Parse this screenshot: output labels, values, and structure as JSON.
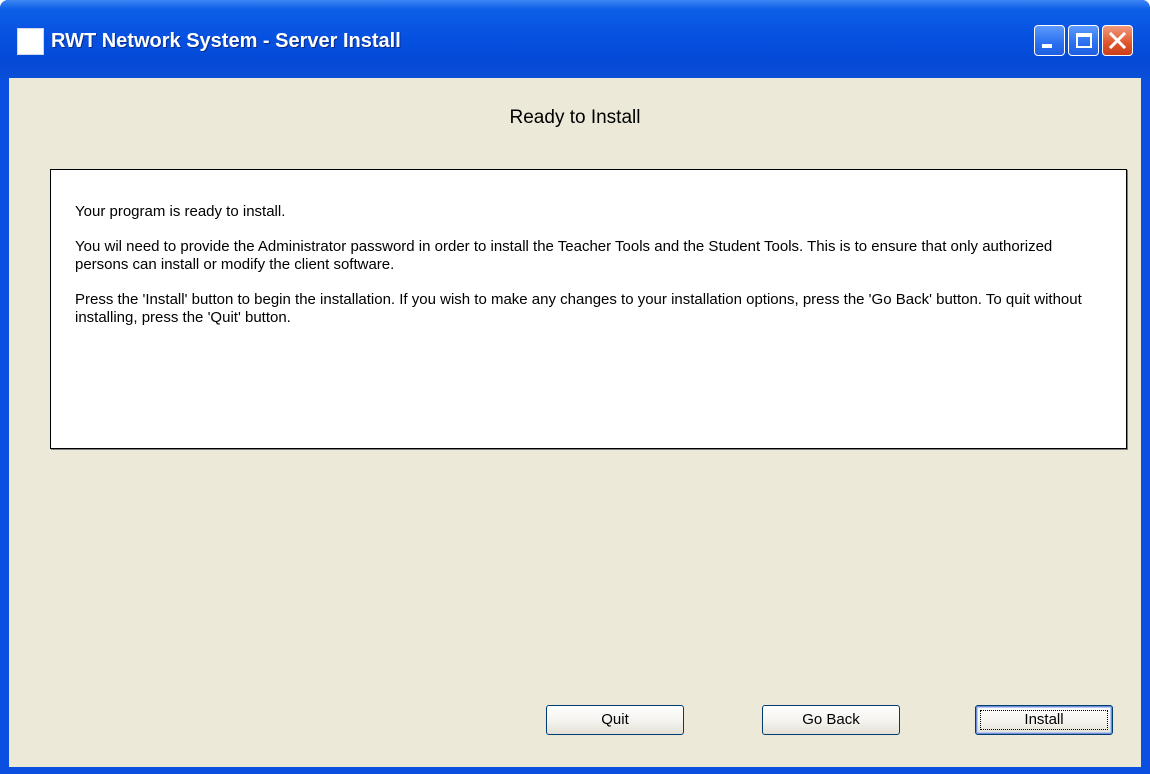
{
  "window": {
    "title": "RWT Network System - Server Install"
  },
  "icons": {
    "app": "app-icon",
    "minimize": "minimize-icon",
    "maximize": "maximize-icon",
    "close": "close-icon"
  },
  "colors": {
    "titlebar": "#0650e0",
    "client_background": "#ece9d8",
    "close_button": "#e0542c"
  },
  "main": {
    "heading": "Ready to Install",
    "paragraphs": [
      "Your program is ready to install.",
      "You wil need to provide the Administrator password in order to install the Teacher Tools and the Student Tools.  This is to ensure that only authorized persons can install or modify the client software.",
      "Press the 'Install' button to begin the installation.  If you wish to make any changes to your installation options, press the 'Go Back' button.  To quit without installing, press the 'Quit' button."
    ]
  },
  "buttons": {
    "quit": "Quit",
    "go_back": "Go Back",
    "install": "Install"
  }
}
